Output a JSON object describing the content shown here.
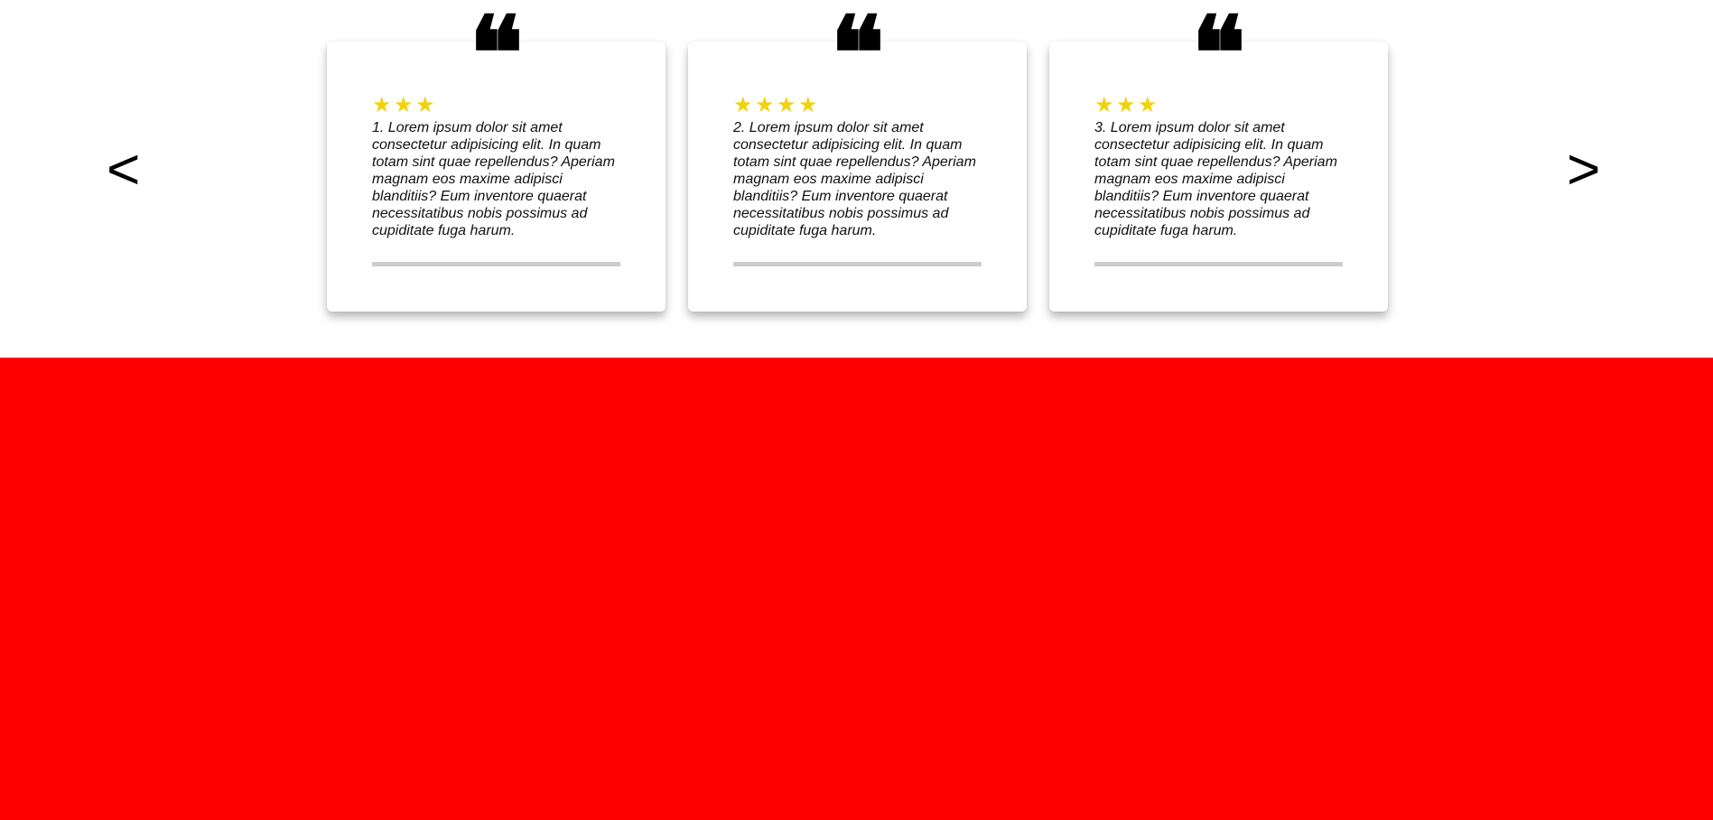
{
  "carousel": {
    "prev_label": "<",
    "next_label": ">"
  },
  "cards": [
    {
      "quote_icon": "quote-icon",
      "rating": 3,
      "rating_stars": "★★★",
      "text": "1. Lorem ipsum dolor sit amet consectetur adipisicing elit. In quam totam sint quae repellendus? Aperiam magnam eos maxime adipisci blanditiis? Eum inventore quaerat necessitatibus nobis possimus ad cupiditate fuga harum."
    },
    {
      "quote_icon": "quote-icon",
      "rating": 4,
      "rating_stars": "★★★★",
      "text": "2. Lorem ipsum dolor sit amet consectetur adipisicing elit. In quam totam sint quae repellendus? Aperiam magnam eos maxime adipisci blanditiis? Eum inventore quaerat necessitatibus nobis possimus ad cupiditate fuga harum."
    },
    {
      "quote_icon": "quote-icon",
      "rating": 3,
      "rating_stars": "★★★",
      "text": "3. Lorem ipsum dolor sit amet consectetur adipisicing elit. In quam totam sint quae repellendus? Aperiam magnam eos maxime adipisci blanditiis? Eum inventore quaerat necessitatibus nobis possimus ad cupiditate fuga harum."
    }
  ],
  "colors": {
    "star": "#f2d10f",
    "section_background": "#ff0000",
    "divider": "#cccccc"
  }
}
